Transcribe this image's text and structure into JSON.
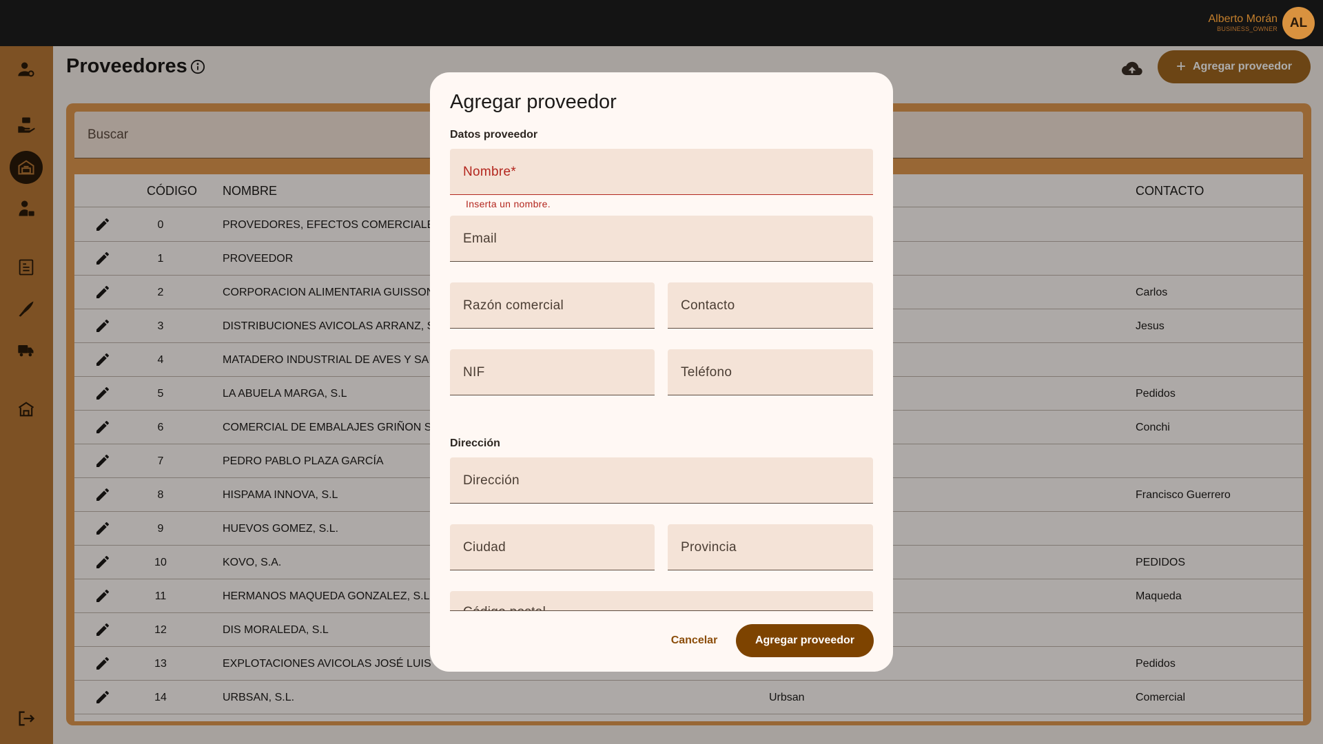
{
  "user": {
    "name": "Alberto Morán",
    "role": "BUSINESS_OWNER",
    "initials": "AL"
  },
  "sidebar": {
    "items": [
      {
        "icon": "user-settings-icon"
      },
      {
        "icon": "hand-box-icon"
      },
      {
        "icon": "warehouse-truck-icon",
        "active": true
      },
      {
        "icon": "delivery-person-icon"
      },
      {
        "icon": "invoice-icon"
      },
      {
        "icon": "knife-icon"
      },
      {
        "icon": "truck-icon"
      },
      {
        "icon": "store-icon"
      },
      {
        "icon": "logout-icon"
      }
    ]
  },
  "page": {
    "title": "Proveedores",
    "add_button": "Agregar proveedor",
    "search_placeholder": "Buscar"
  },
  "table": {
    "headers": {
      "code": "CÓDIGO",
      "name": "NOMBRE",
      "contact": "CONTACTO"
    },
    "rows": [
      {
        "code": "0",
        "name": "PROVEDORES, EFECTOS COMERCIALES",
        "trade": "",
        "contact": ""
      },
      {
        "code": "1",
        "name": "PROVEEDOR",
        "trade": "",
        "contact": ""
      },
      {
        "code": "2",
        "name": "CORPORACION ALIMENTARIA GUISSONA",
        "trade": "",
        "contact": "Carlos"
      },
      {
        "code": "3",
        "name": "DISTRIBUCIONES AVICOLAS ARRANZ, S",
        "trade": "",
        "contact": "Jesus"
      },
      {
        "code": "4",
        "name": "MATADERO INDUSTRIAL DE AVES Y SA",
        "trade": "",
        "contact": ""
      },
      {
        "code": "5",
        "name": "LA ABUELA MARGA, S.L",
        "trade": "",
        "contact": "Pedidos"
      },
      {
        "code": "6",
        "name": "COMERCIAL DE EMBALAJES GRIÑON S",
        "trade": "",
        "contact": "Conchi"
      },
      {
        "code": "7",
        "name": "PEDRO PABLO PLAZA GARCÍA",
        "trade": "",
        "contact": ""
      },
      {
        "code": "8",
        "name": "HISPAMA INNOVA, S.L",
        "trade": "",
        "contact": "Francisco Guerrero"
      },
      {
        "code": "9",
        "name": "HUEVOS GOMEZ, S.L.",
        "trade": "",
        "contact": ""
      },
      {
        "code": "10",
        "name": "KOVO, S.A.",
        "trade": "",
        "contact": "PEDIDOS"
      },
      {
        "code": "11",
        "name": "HERMANOS MAQUEDA GONZALEZ, S.L",
        "trade": "",
        "contact": "Maqueda"
      },
      {
        "code": "12",
        "name": "DIS MORALEDA, S.L",
        "trade": "",
        "contact": ""
      },
      {
        "code": "13",
        "name": "EXPLOTACIONES AVICOLAS JOSÉ LUIS",
        "trade": "",
        "contact": "Pedidos"
      },
      {
        "code": "14",
        "name": "URBSAN, S.L.",
        "trade": "Urbsan",
        "contact": "Comercial"
      }
    ]
  },
  "dialog": {
    "title": "Agregar proveedor",
    "section_supplier": "Datos proveedor",
    "name_label": "Nombre*",
    "name_error": "Inserta un nombre.",
    "email_label": "Email",
    "trade_name_label": "Razón comercial",
    "contact_label": "Contacto",
    "nif_label": "NIF",
    "phone_label": "Teléfono",
    "section_address": "Dirección",
    "address_label": "Dirección",
    "city_label": "Ciudad",
    "province_label": "Provincia",
    "postal_code_label": "Código postal",
    "cancel": "Cancelar",
    "submit": "Agregar proveedor"
  },
  "colors": {
    "topbar": "#141414",
    "sidebar": "#b87835",
    "accent": "#a0661f",
    "submit": "#7d4300",
    "error": "#b3261e"
  }
}
